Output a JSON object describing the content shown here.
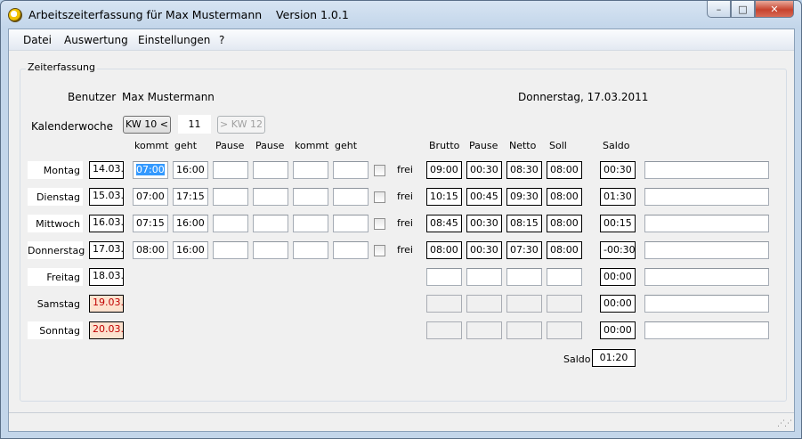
{
  "window": {
    "title": "Arbeitszeiterfassung für Max Mustermann    Version 1.0.1",
    "minimize": "–",
    "maximize": "□",
    "close": "✕"
  },
  "menu": [
    "Datei",
    "Auswertung",
    "Einstellungen",
    "?"
  ],
  "group_title": "Zeiterfassung",
  "user": {
    "label": "Benutzer",
    "name": "Max Mustermann"
  },
  "current_date": "Donnerstag, 17.03.2011",
  "week": {
    "label": "Kalenderwoche",
    "prev": "KW 10 <",
    "number": "11",
    "next": "> KW 12"
  },
  "headers": {
    "kommt": "kommt",
    "geht": "geht",
    "pause1": "Pause",
    "pause2": "Pause",
    "kommt2": "kommt",
    "geht2": "geht",
    "brutto": "Brutto",
    "pause": "Pause",
    "netto": "Netto",
    "soll": "Soll",
    "saldo": "Saldo"
  },
  "frei_label": "frei",
  "days": [
    {
      "name": "Montag",
      "date": "14.03.",
      "kommt": "07:00",
      "geht": "16:00",
      "brutto": "09:00",
      "pause": "00:30",
      "netto": "08:30",
      "soll": "08:00",
      "saldo": "00:30"
    },
    {
      "name": "Dienstag",
      "date": "15.03.",
      "kommt": "07:00",
      "geht": "17:15",
      "brutto": "10:15",
      "pause": "00:45",
      "netto": "09:30",
      "soll": "08:00",
      "saldo": "01:30"
    },
    {
      "name": "Mittwoch",
      "date": "16.03.",
      "kommt": "07:15",
      "geht": "16:00",
      "brutto": "08:45",
      "pause": "00:30",
      "netto": "08:15",
      "soll": "08:00",
      "saldo": "00:15"
    },
    {
      "name": "Donnerstag",
      "date": "17.03.",
      "kommt": "08:00",
      "geht": "16:00",
      "brutto": "08:00",
      "pause": "00:30",
      "netto": "07:30",
      "soll": "08:00",
      "saldo": "-00:30"
    },
    {
      "name": "Freitag",
      "date": "18.03.",
      "saldo": "00:00"
    },
    {
      "name": "Samstag",
      "date": "19.03.",
      "saldo": "00:00"
    },
    {
      "name": "Sonntag",
      "date": "20.03.",
      "saldo": "00:00"
    }
  ],
  "total": {
    "label": "Saldo",
    "value": "01:20"
  }
}
